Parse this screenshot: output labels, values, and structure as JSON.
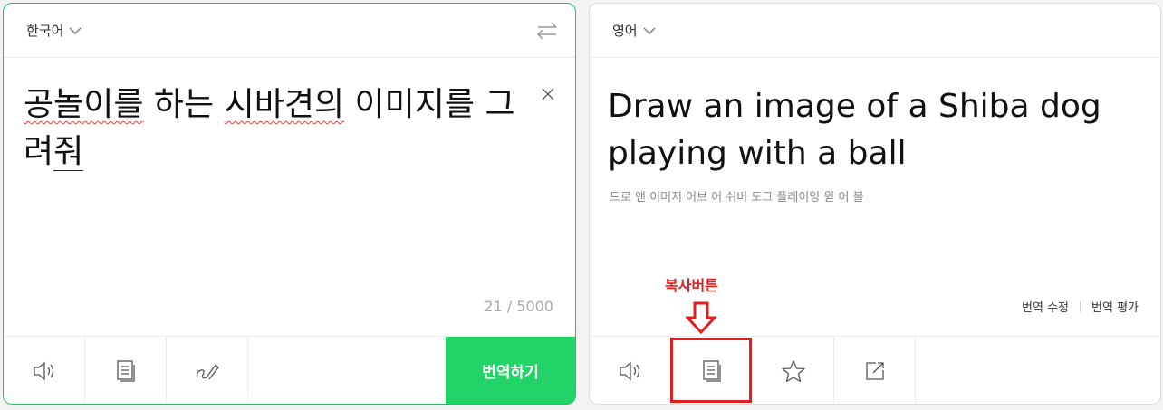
{
  "source": {
    "language": "한국어",
    "text_parts": [
      "공놀이를",
      " 하는 ",
      "시바견의",
      " 이미지를 그려",
      "줘"
    ],
    "char_count": "21 / 5000",
    "translate_label": "번역하기"
  },
  "target": {
    "language": "영어",
    "text": "Draw an image of a Shiba dog playing with a ball",
    "pronunciation": "드로 앤 이머지 어브 어 쉬버 도그 플레이잉 윋 어 볼",
    "edit_label": "번역 수정",
    "rate_label": "번역 평가"
  },
  "annotation": {
    "label": "복사버튼",
    "color": "#e02020"
  },
  "colors": {
    "accent": "#22d468",
    "border_active": "#1ec95a"
  },
  "icons": {
    "source_toolbar": [
      "speaker-icon",
      "copy-icon",
      "handwriting-icon"
    ],
    "target_toolbar": [
      "speaker-icon",
      "copy-icon",
      "star-icon",
      "share-icon"
    ]
  }
}
